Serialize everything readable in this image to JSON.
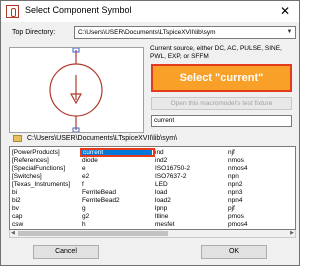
{
  "window": {
    "title": "Select Component Symbol",
    "close_glyph": "✕"
  },
  "top_directory": {
    "label": "Top Directory:",
    "value": "C:\\Users\\USER\\Documents\\LTspiceXVII\\lib\\sym"
  },
  "description": "Current source, either DC, AC, PULSE, SINE, PWL, EXP, or SFFM",
  "callout": "Select \"current\"",
  "open_macromodel_button": "Open this macromodel's test fixture",
  "search": {
    "value": "current"
  },
  "folder_path": "C:\\Users\\USER\\Documents\\LTspiceXVII\\lib\\sym\\",
  "list": {
    "columns": [
      [
        "[PowerProducts]",
        "[References]",
        "[SpecialFunctions]",
        "[Switches]",
        "[Texas_Instruments]",
        "bi",
        "bi2",
        "bv",
        "cap",
        "csw"
      ],
      [
        "current",
        "diode",
        "e",
        "e2",
        "f",
        "FerriteBead",
        "FerriteBead2",
        "g",
        "g2",
        "h"
      ],
      [
        "ind",
        "ind2",
        "ISO16750-2",
        "ISO7637-2",
        "LED",
        "load",
        "load2",
        "lpnp",
        "ltline",
        "mesfet"
      ],
      [
        "njf",
        "nmos",
        "nmos4",
        "npn",
        "npn2",
        "npn3",
        "npn4",
        "pjf",
        "pmos",
        "pmos4"
      ]
    ],
    "selected": "current"
  },
  "buttons": {
    "cancel": "Cancel",
    "ok": "OK"
  },
  "colors": {
    "callout_fill": "#f8a028",
    "callout_border": "#e53a1e",
    "selection": "#0078d7",
    "symbol_stroke": "#b0382b"
  },
  "icons": {
    "app": "component-symbol-icon",
    "folder": "folder-icon",
    "dropdown": "chevron-down-icon"
  }
}
